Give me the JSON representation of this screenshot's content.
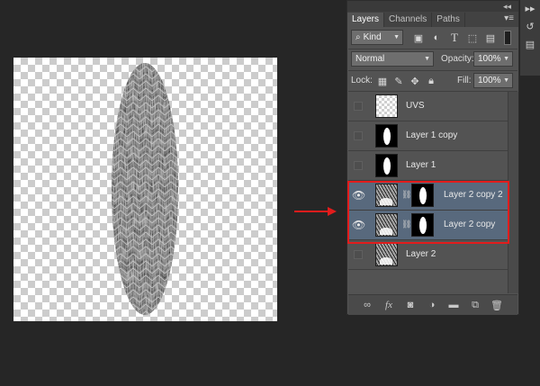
{
  "panel": {
    "tabs": [
      {
        "label": "Layers",
        "active": true
      },
      {
        "label": "Channels",
        "active": false
      },
      {
        "label": "Paths",
        "active": false
      }
    ],
    "collapse_icon": "double-chevron-icon",
    "menu_icon": "panel-menu-icon",
    "filter": {
      "kind_label": "Kind",
      "icons": [
        "image-filter-icon",
        "adjustment-filter-icon",
        "type-filter-icon",
        "shape-filter-icon",
        "smart-object-filter-icon"
      ]
    },
    "blend_mode": "Normal",
    "opacity_label": "Opacity:",
    "opacity_value": "100%",
    "lock_label": "Lock:",
    "lock_icons": [
      "lock-transparent-icon",
      "lock-image-icon",
      "lock-position-icon",
      "lock-all-icon"
    ],
    "fill_label": "Fill:",
    "fill_value": "100%"
  },
  "layers": [
    {
      "name": "UVS",
      "visible": false,
      "selected": false,
      "thumb": "checker",
      "mask": false
    },
    {
      "name": "Layer 1 copy",
      "visible": false,
      "selected": false,
      "thumb": "black-oval",
      "mask": false
    },
    {
      "name": "Layer 1",
      "visible": false,
      "selected": false,
      "thumb": "black-oval",
      "mask": false
    },
    {
      "name": "Layer 2 copy 2",
      "visible": true,
      "selected": true,
      "thumb": "noise",
      "mask": true
    },
    {
      "name": "Layer 2 copy",
      "visible": true,
      "selected": true,
      "thumb": "noise",
      "mask": true
    },
    {
      "name": "Layer 2",
      "visible": false,
      "selected": false,
      "thumb": "noise",
      "mask": false
    }
  ],
  "bottom_icons": [
    "link-layers-icon",
    "fx-icon",
    "add-mask-icon",
    "adjustment-layer-icon",
    "new-group-icon",
    "new-layer-icon",
    "delete-icon"
  ],
  "colors": {
    "background": "#262626",
    "panel": "#535353",
    "selected_layer": "#58697d",
    "highlight": "#e21c1c",
    "arrow": "#e21c1c"
  }
}
